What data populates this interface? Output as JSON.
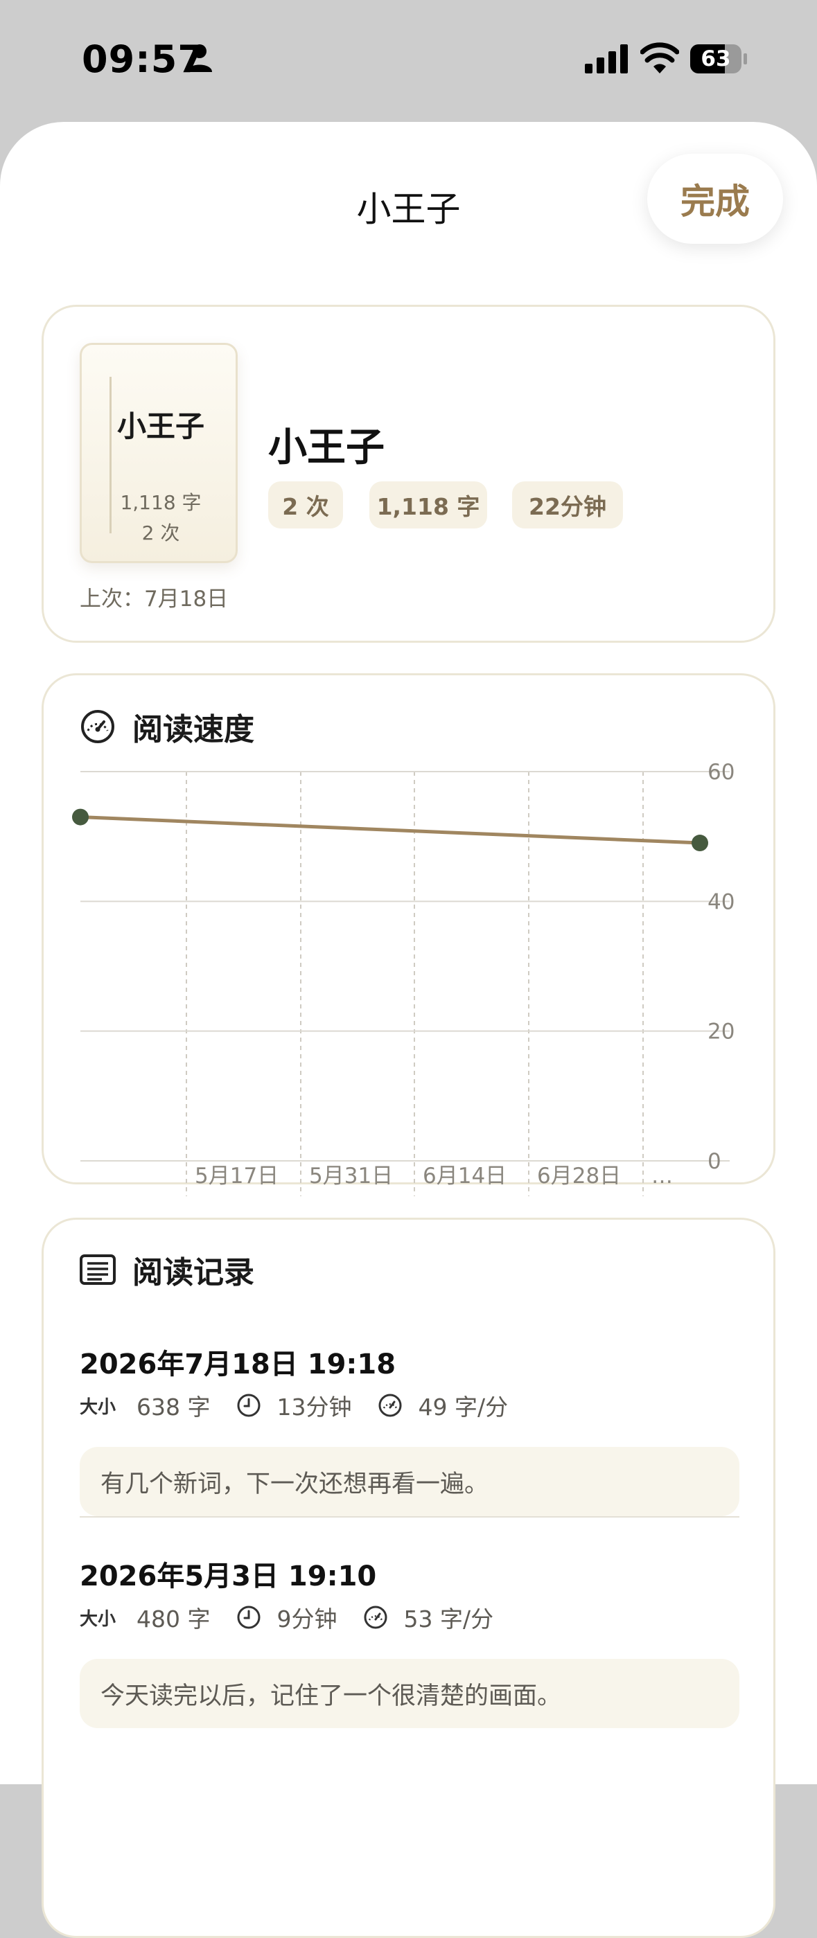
{
  "status_bar": {
    "time": "09:57",
    "battery": "63"
  },
  "header": {
    "title": "小王子",
    "done_label": "完成"
  },
  "book": {
    "cover_title": "小王子",
    "cover_chars": "1,118 字",
    "cover_count": "2 次",
    "name": "小王子",
    "chips": [
      "2 次",
      "1,118 字",
      "22分钟"
    ],
    "last_read": "上次：7月18日"
  },
  "speed": {
    "title": "阅读速度"
  },
  "chart_data": {
    "type": "line",
    "title": "阅读速度",
    "x": [
      "2026-05-03",
      "2026-07-18"
    ],
    "series": [
      {
        "values": [
          53,
          49
        ]
      }
    ],
    "x_tick_labels": [
      "5月17日",
      "5月31日",
      "6月14日",
      "6月28日",
      "…"
    ],
    "y_ticks": [
      0,
      20,
      40,
      60
    ],
    "ylim": [
      0,
      60
    ],
    "grid": true,
    "line_color": "#a08660",
    "point_color": "#465a3f"
  },
  "log": {
    "title": "阅读记录",
    "entries": [
      {
        "date": "2026年7月18日 19:18",
        "size_label": "大小",
        "chars": "638 字",
        "duration": "13分钟",
        "speed": "49 字/分",
        "note": "有几个新词，下一次还想再看一遍。"
      },
      {
        "date": "2026年5月3日 19:10",
        "size_label": "大小",
        "chars": "480 字",
        "duration": "9分钟",
        "speed": "53 字/分",
        "note": "今天读完以后，记住了一个很清楚的画面。"
      }
    ]
  }
}
